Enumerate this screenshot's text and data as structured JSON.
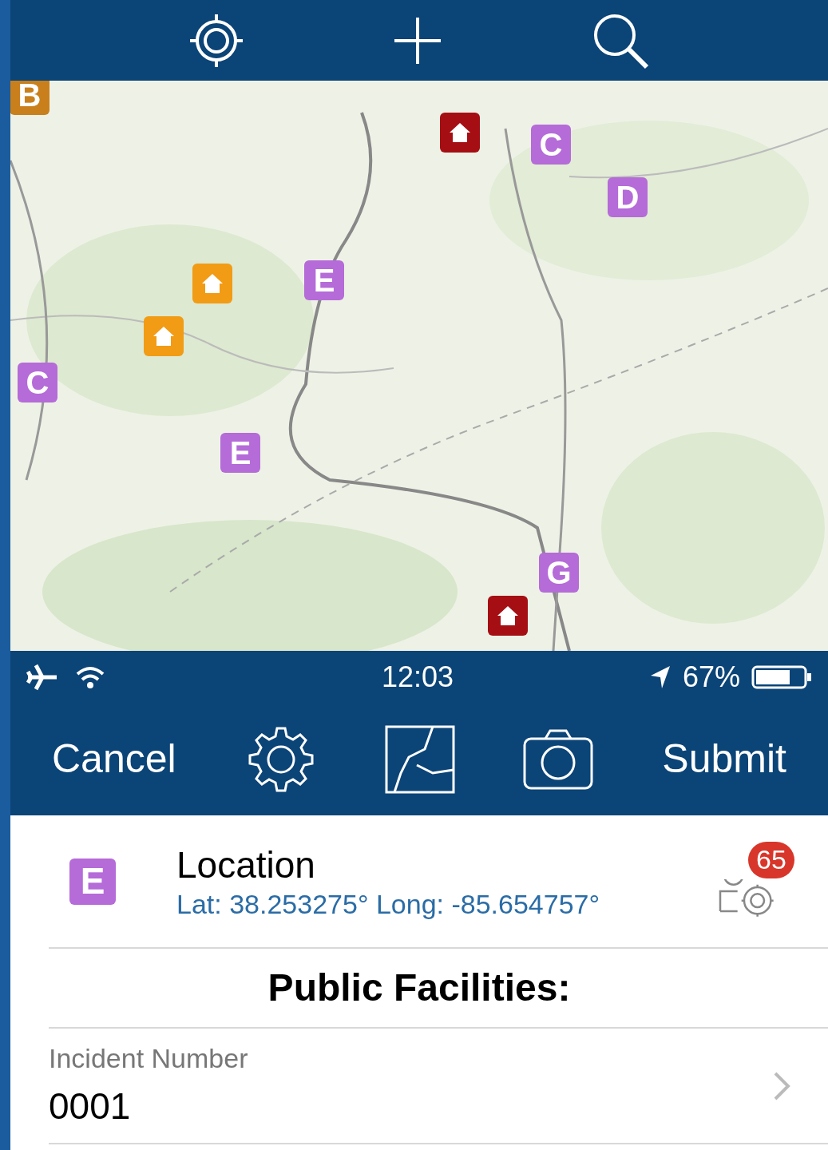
{
  "top_toolbar": {
    "buttons": [
      {
        "kind": "locate"
      },
      {
        "kind": "add"
      },
      {
        "kind": "search"
      }
    ]
  },
  "map": {
    "pins": [
      {
        "kind": "letter",
        "label": "B",
        "color": "#c9801c"
      },
      {
        "kind": "house",
        "color": "#a50f14"
      },
      {
        "kind": "letter",
        "label": "C",
        "color": "#b56bd8"
      },
      {
        "kind": "letter",
        "label": "D",
        "color": "#b56bd8"
      },
      {
        "kind": "house",
        "color": "#f29b14"
      },
      {
        "kind": "letter",
        "label": "E",
        "color": "#b56bd8"
      },
      {
        "kind": "house",
        "color": "#f29b14"
      },
      {
        "kind": "letter",
        "label": "C",
        "color": "#b56bd8"
      },
      {
        "kind": "letter",
        "label": "E",
        "color": "#b56bd8"
      },
      {
        "kind": "letter",
        "label": "G",
        "color": "#b56bd8"
      },
      {
        "kind": "house",
        "color": "#a50f14"
      }
    ]
  },
  "status_bar": {
    "time": "12:03",
    "battery_text": "67%"
  },
  "toolbar": {
    "cancel": "Cancel",
    "submit": "Submit"
  },
  "location": {
    "marker": "E",
    "color": "#b56bd8",
    "title": "Location",
    "coords": "Lat: 38.253275° Long: -85.654757°",
    "badge": "65"
  },
  "section_title": "Public Facilities:",
  "fields": [
    {
      "label": "Incident Number",
      "value": "0001"
    }
  ]
}
